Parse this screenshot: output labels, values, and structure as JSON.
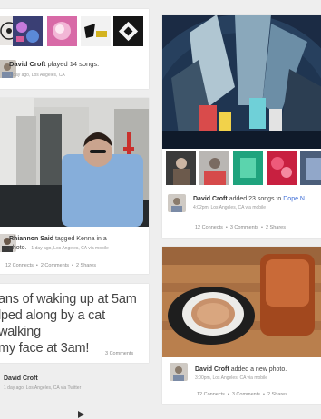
{
  "cards": {
    "played": {
      "user": "David Croft",
      "action": "played 14 songs.",
      "meta": "1 day ago, Los Angeles, CA"
    },
    "tagged": {
      "user": "Rhiannon Said",
      "action": "tagged Kenna in a",
      "action2": "photo.",
      "meta": "1 day ago, Los Angeles, CA via mobile",
      "footer": {
        "connects": "12 Connects",
        "comments": "2 Comments",
        "shares": "2 Shares"
      }
    },
    "songs": {
      "user": "David Croft",
      "action": "added 23 songs to",
      "link": "Dope N",
      "meta": "4:02pm, Los Angeles, CA via mobile",
      "footer": {
        "connects": "12 Connects",
        "comments": "3 Comments",
        "shares": "2 Shares"
      }
    },
    "text": {
      "line1": "ans of waking up at 5am",
      "line2": "lped along by a cat walking",
      "line3": "my face at 3am!",
      "comments": "3 Comments",
      "user": "David Croft",
      "meta": "1 day ago, Los Angeles, CA via Twitter"
    },
    "photo": {
      "user": "David Croft",
      "action": "added a new photo.",
      "meta": "3:00pm, Los Angeles, CA via mobile",
      "footer": {
        "connects": "12 Connects",
        "comments": "3 Comments",
        "shares": "2 Shares"
      }
    }
  },
  "colors": {
    "background": "#eeeeee",
    "card": "#ffffff",
    "link": "#3b6bd6"
  },
  "icons": [
    "album-thumb",
    "avatar",
    "play-icon"
  ]
}
